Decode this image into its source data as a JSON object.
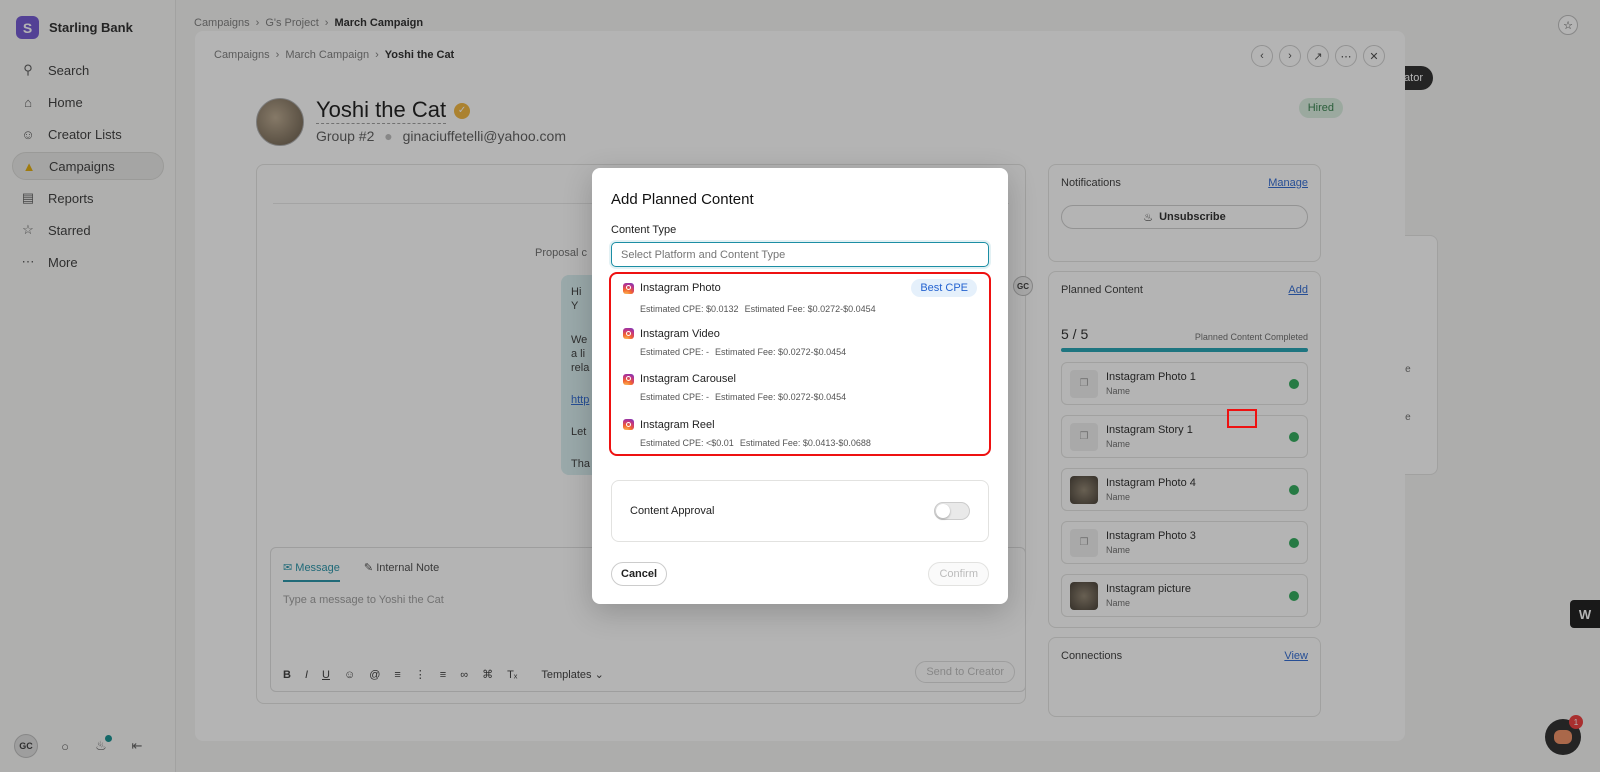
{
  "app": {
    "brand": "Starling Bank",
    "logo_letter": "S"
  },
  "sidebar": {
    "items": [
      {
        "label": "Search",
        "icon": "search-icon"
      },
      {
        "label": "Home",
        "icon": "home-icon"
      },
      {
        "label": "Creator Lists",
        "icon": "people-icon"
      },
      {
        "label": "Campaigns",
        "icon": "megaphone-icon",
        "active": true
      },
      {
        "label": "Reports",
        "icon": "chart-icon"
      },
      {
        "label": "Starred",
        "icon": "star-icon"
      },
      {
        "label": "More",
        "icon": "more-icon"
      }
    ],
    "user_initials": "GC"
  },
  "top_breadcrumb": [
    "Campaigns",
    "G's Project",
    "March Campaign"
  ],
  "panel": {
    "breadcrumb": [
      "Campaigns",
      "March Campaign",
      "Yoshi the Cat"
    ],
    "profile": {
      "name": "Yoshi the Cat",
      "group": "Group #2",
      "email": "ginaciuffetelli@yahoo.com",
      "status": "Hired"
    },
    "chat": {
      "proposal_text": "Proposal c",
      "bubble_lines": [
        "Hi Y",
        "We",
        "a li",
        "rela",
        "http",
        "Let",
        "Tha"
      ],
      "avatar_initials": "GC"
    },
    "composer": {
      "tab_message": "Message",
      "tab_note": "Internal Note",
      "placeholder": "Type a message to Yoshi the Cat",
      "templates": "Templates",
      "send": "Send to Creator"
    },
    "notifications": {
      "title": "Notifications",
      "manage": "Manage",
      "unsubscribe": "Unsubscribe"
    },
    "planned": {
      "title": "Planned Content",
      "add": "Add",
      "count": "5 / 5",
      "completed_label": "Planned Content Completed",
      "progress": 1.0,
      "items": [
        {
          "title": "Instagram Photo 1",
          "sub": "Name",
          "thumb": "placeholder"
        },
        {
          "title": "Instagram Story 1",
          "sub": "Name",
          "thumb": "placeholder"
        },
        {
          "title": "Instagram Photo 4",
          "sub": "Name",
          "thumb": "photo"
        },
        {
          "title": "Instagram Photo 3",
          "sub": "Name",
          "thumb": "placeholder"
        },
        {
          "title": "Instagram picture",
          "sub": "Name",
          "thumb": "photo"
        }
      ]
    },
    "connections": {
      "title": "Connections",
      "view": "View"
    }
  },
  "background": {
    "pill": "ator",
    "side_text_1": "ot Pre",
    "side_text_2": "ot Pre"
  },
  "modal": {
    "title": "Add Planned Content",
    "content_type_label": "Content Type",
    "input_placeholder": "Select Platform and Content Type",
    "options": [
      {
        "name": "Instagram Photo",
        "cpe": "Estimated CPE: $0.0132",
        "fee": "Estimated Fee: $0.0272-$0.0454",
        "badge": "Best CPE"
      },
      {
        "name": "Instagram Video",
        "cpe": "Estimated CPE: -",
        "fee": "Estimated Fee: $0.0272-$0.0454",
        "badge": ""
      },
      {
        "name": "Instagram Carousel",
        "cpe": "Estimated CPE: -",
        "fee": "Estimated Fee: $0.0272-$0.0454",
        "badge": ""
      },
      {
        "name": "Instagram Reel",
        "cpe": "Estimated CPE: <$0.01",
        "fee": "Estimated Fee: $0.0413-$0.0688",
        "badge": ""
      }
    ],
    "approval_label": "Content Approval",
    "approval_on": false,
    "cancel": "Cancel",
    "confirm": "Confirm"
  },
  "widget": {
    "w_label": "W",
    "chat_badge": "1"
  }
}
